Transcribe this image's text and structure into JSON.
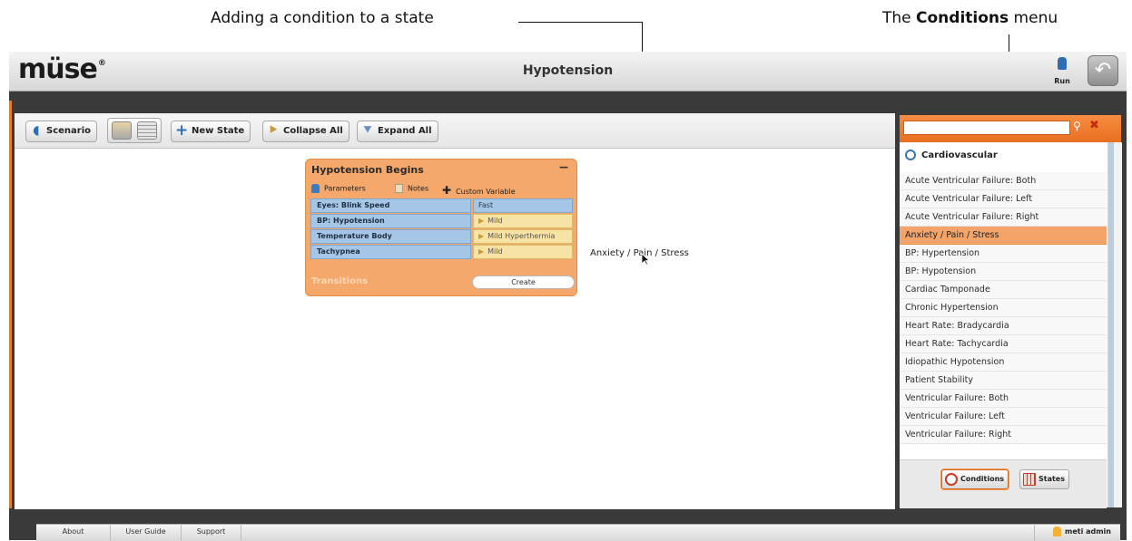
{
  "annotations": {
    "left": "Adding a condition to a state",
    "right_prefix": "The ",
    "right_bold": "Conditions",
    "right_suffix": " menu"
  },
  "app": {
    "logo": "müse",
    "title": "Hypotension",
    "run_label": "Run"
  },
  "toolbar": {
    "scenario": "Scenario",
    "new_state": "New State",
    "collapse_all": "Collapse All",
    "expand_all": "Expand All"
  },
  "state_card": {
    "title": "Hypotension Begins",
    "collapse_symbol": "−",
    "nav": {
      "parameters": "Parameters",
      "notes": "Notes",
      "custom_variable": "Custom Variable"
    },
    "rows": [
      {
        "name": "Eyes: Blink Speed",
        "value": "Fast"
      },
      {
        "name": "BP: Hypotension",
        "value": "Mild"
      },
      {
        "name": "Temperature Body",
        "value": "Mild Hyperthermia"
      },
      {
        "name": "Tachypnea",
        "value": "Mild"
      }
    ],
    "transitions_label": "Transitions",
    "create_label": "Create"
  },
  "dragged_item": "Anxiety / Pain / Stress",
  "sidebar": {
    "search_value": "",
    "category": "Cardiovascular",
    "selected_index": 3,
    "items": [
      "Acute Ventricular Failure: Both",
      "Acute Ventricular Failure: Left",
      "Acute Ventricular Failure: Right",
      "Anxiety / Pain / Stress",
      "BP: Hypertension",
      "BP: Hypotension",
      "Cardiac Tamponade",
      "Chronic Hypertension",
      "Heart Rate: Bradycardia",
      "Heart Rate: Tachycardia",
      "Idiopathic Hypotension",
      "Patient Stability",
      "Ventricular Failure: Both",
      "Ventricular Failure: Left",
      "Ventricular Failure: Right"
    ],
    "tabs": {
      "conditions": "Conditions",
      "states": "States"
    }
  },
  "footer": {
    "about": "About",
    "user_guide": "User Guide",
    "support": "Support",
    "user": "meti admin"
  },
  "colors": {
    "accent_orange": "#e96f20",
    "state_card": "#f4a86b",
    "param_blue": "#a5c6e6",
    "param_yellow": "#f7e3a3"
  }
}
